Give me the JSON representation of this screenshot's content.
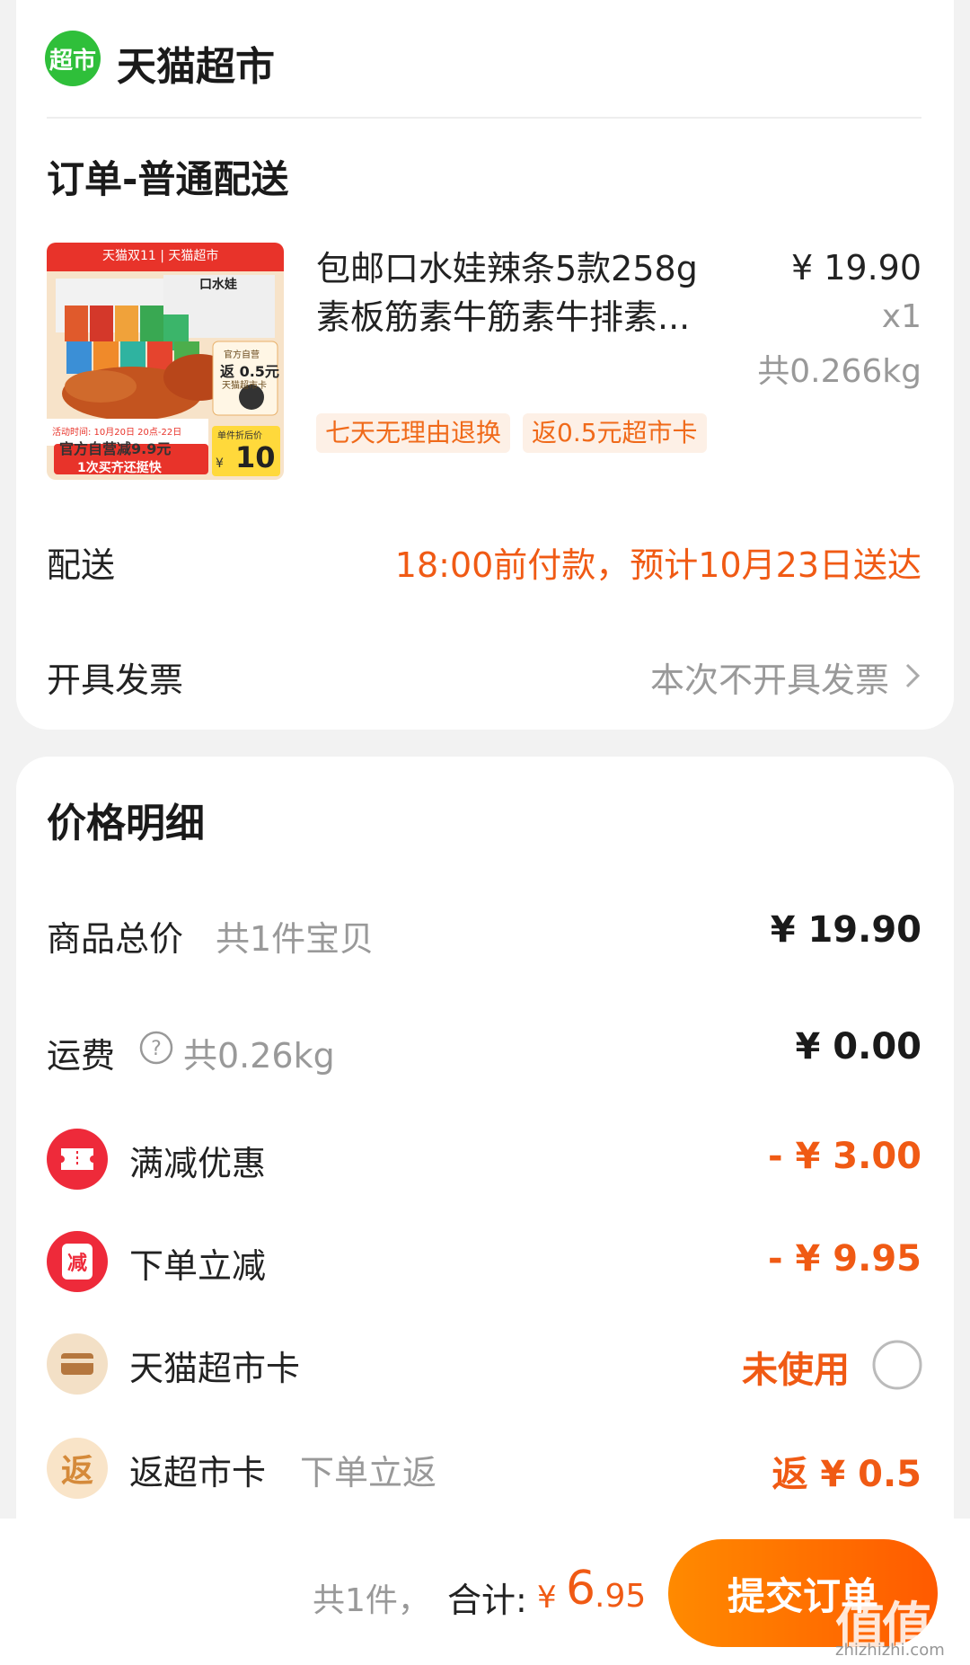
{
  "store": {
    "logo_text": "超市",
    "name": "天猫超市"
  },
  "order": {
    "section_title": "订单-普通配送",
    "product": {
      "name": "包邮口水娃辣条5款258g素板筋素牛筋素牛排素...",
      "price": "¥ 19.90",
      "quantity": "x1",
      "weight": "共0.266kg",
      "tags": [
        "七天无理由退换",
        "返0.5元超市卡"
      ],
      "thumb": {
        "banner": "天猫双11 | 天猫超市",
        "brand": "口水娃",
        "badge_line1": "官方自营",
        "badge_line2": "返 0.5元",
        "badge_line3": "天猫超市卡",
        "activity": "活动时间: 10月20日 20点-22日",
        "promo": "官方自营减9.9元",
        "promo_sub": "1次买齐还挺快",
        "unit_label": "单件折后价",
        "unit_price": "10",
        "yen": "¥"
      }
    },
    "delivery": {
      "label": "配送",
      "value": "18:00前付款，预计10月23日送达"
    },
    "invoice": {
      "label": "开具发票",
      "value": "本次不开具发票"
    }
  },
  "price_detail": {
    "title": "价格明细",
    "goods_total": {
      "label": "商品总价",
      "sub": "共1件宝贝",
      "amount": "¥ 19.90"
    },
    "shipping": {
      "label": "运费",
      "sub": "共0.26kg",
      "amount": "¥ 0.00"
    },
    "full_reduction": {
      "label": "满减优惠",
      "amount": "- ¥ 3.00"
    },
    "order_reduction": {
      "icon_text": "减",
      "label": "下单立减",
      "amount": "- ¥ 9.95"
    },
    "market_card": {
      "label": "天猫超市卡",
      "status": "未使用"
    },
    "return_card": {
      "icon_text": "返",
      "label": "返超市卡",
      "sub": "下单立返",
      "amount": "返 ¥ 0.5"
    }
  },
  "bottom_bar": {
    "count": "共1件，",
    "total_label": "合计:",
    "currency": "¥",
    "total_main": "6",
    "total_decimal": ".95",
    "submit": "提交订单"
  },
  "watermark": {
    "main": "值值值",
    "sub": "zhizhizhi.com"
  },
  "colors": {
    "accent_orange": "#f05a14",
    "brand_green": "#2fbf3a",
    "button": "#ff6a00"
  }
}
